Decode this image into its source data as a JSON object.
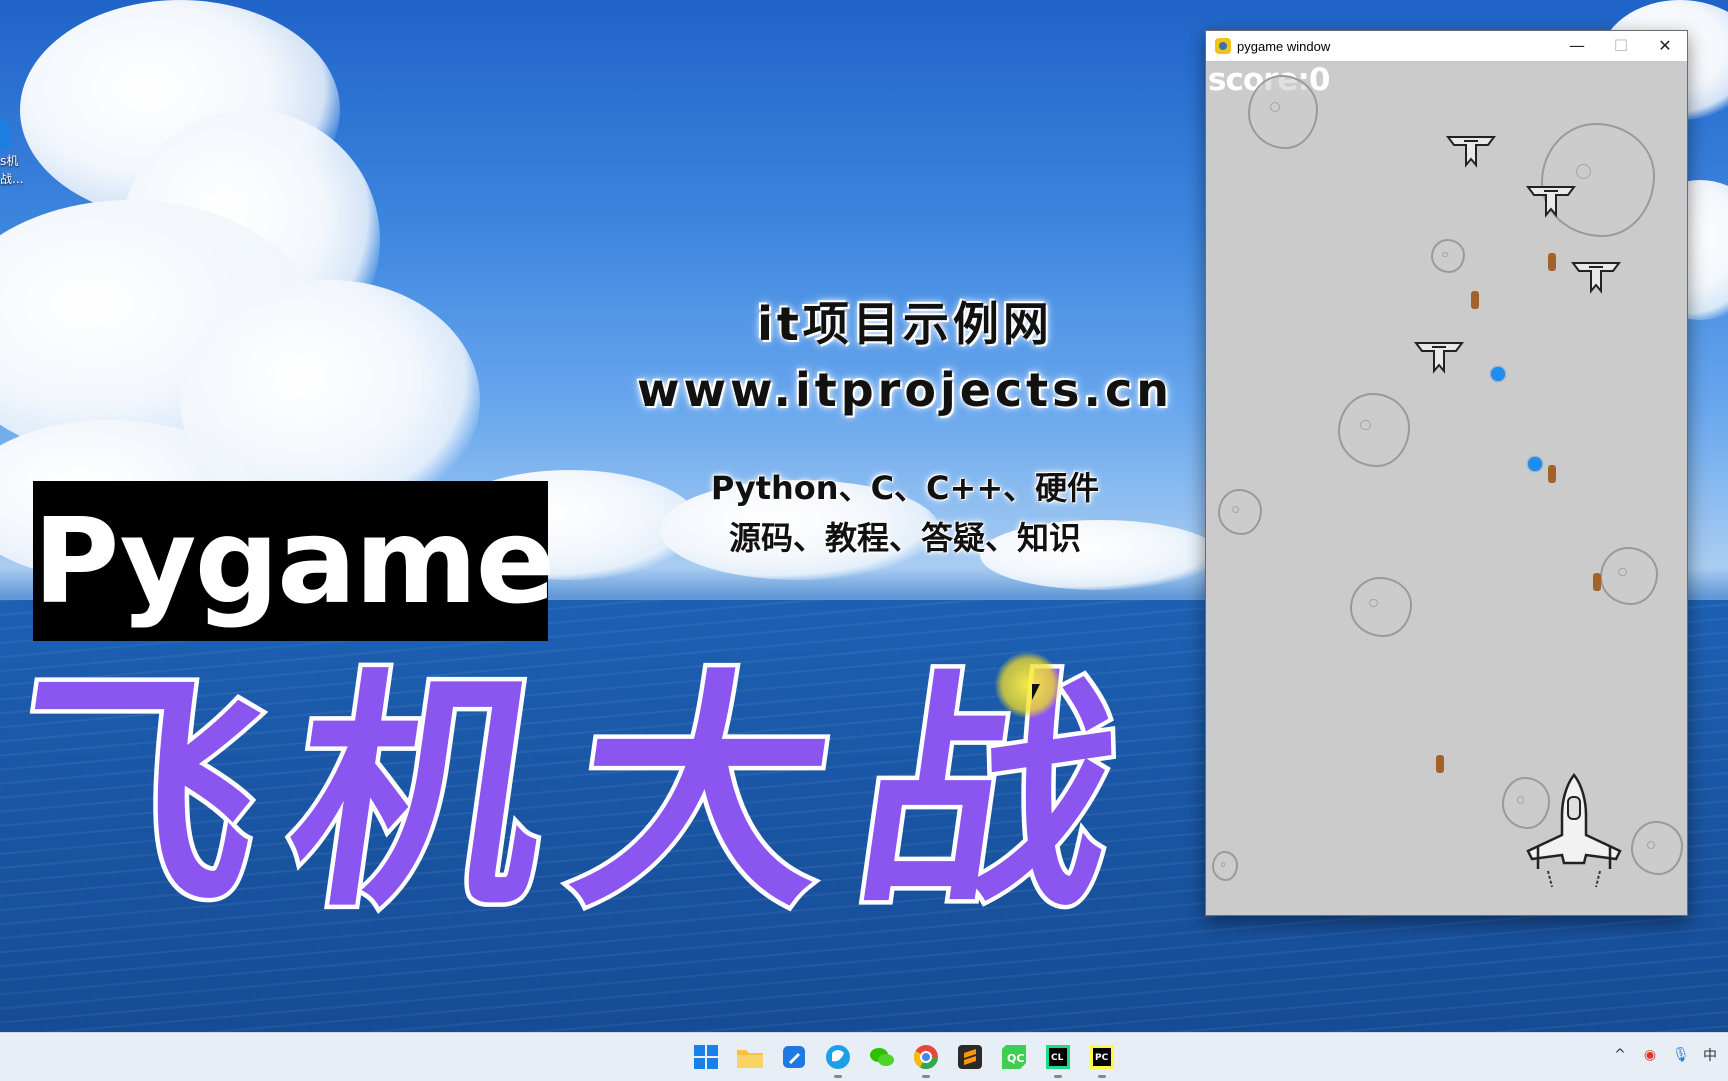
{
  "desktop": {
    "icon_label_1": "s机",
    "icon_label_2": "战..."
  },
  "overlay": {
    "site_name": "it项目示例网",
    "site_url": "www.itprojects.cn",
    "tagline_1": "Python、C、C++、硬件",
    "tagline_2": "源码、教程、答疑、知识",
    "badge": "Pygame",
    "big_title": "飞机大战"
  },
  "window": {
    "title": "pygame window",
    "minimize": "—",
    "maximize": "☐",
    "close": "✕"
  },
  "game": {
    "score_text": "score:0"
  },
  "colors": {
    "accent_purple": "#8b55f0",
    "game_bg": "#cbcbcb",
    "bullet": "#a4622b",
    "orb": "#1f8cf0"
  },
  "taskbar": {
    "icons": [
      "windows-start-icon",
      "file-explorer-icon",
      "notes-app-icon",
      "browser-icon",
      "wechat-icon",
      "chrome-icon",
      "sublime-text-icon",
      "qt-creator-icon",
      "clion-icon",
      "pycharm-icon"
    ],
    "tray": {
      "chevron": "^",
      "ime": "中"
    }
  }
}
